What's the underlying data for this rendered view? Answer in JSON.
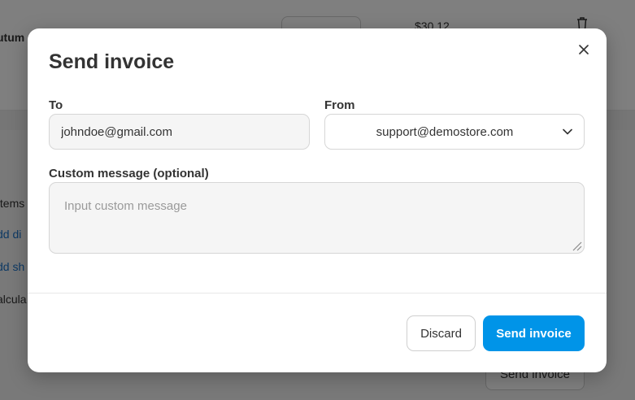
{
  "background": {
    "row_title": "utum",
    "row_price": "$30.12",
    "items_label": "Items",
    "add_discount_link": "dd di",
    "add_shipping_link": "dd sh",
    "calculate_text": "alcula",
    "send_invoice_label": "Send invoice"
  },
  "modal": {
    "title": "Send invoice",
    "to": {
      "label": "To",
      "value": "johndoe@gmail.com"
    },
    "from": {
      "label": "From",
      "selected": "support@demostore.com"
    },
    "custom_message": {
      "label": "Custom message (optional)",
      "placeholder": "Input custom message",
      "value": ""
    },
    "footer": {
      "discard_label": "Discard",
      "send_label": "Send invoice"
    }
  },
  "colors": {
    "primary": "#0094e8",
    "overlay": "rgba(0,0,0,0.5)",
    "text": "#333333"
  }
}
